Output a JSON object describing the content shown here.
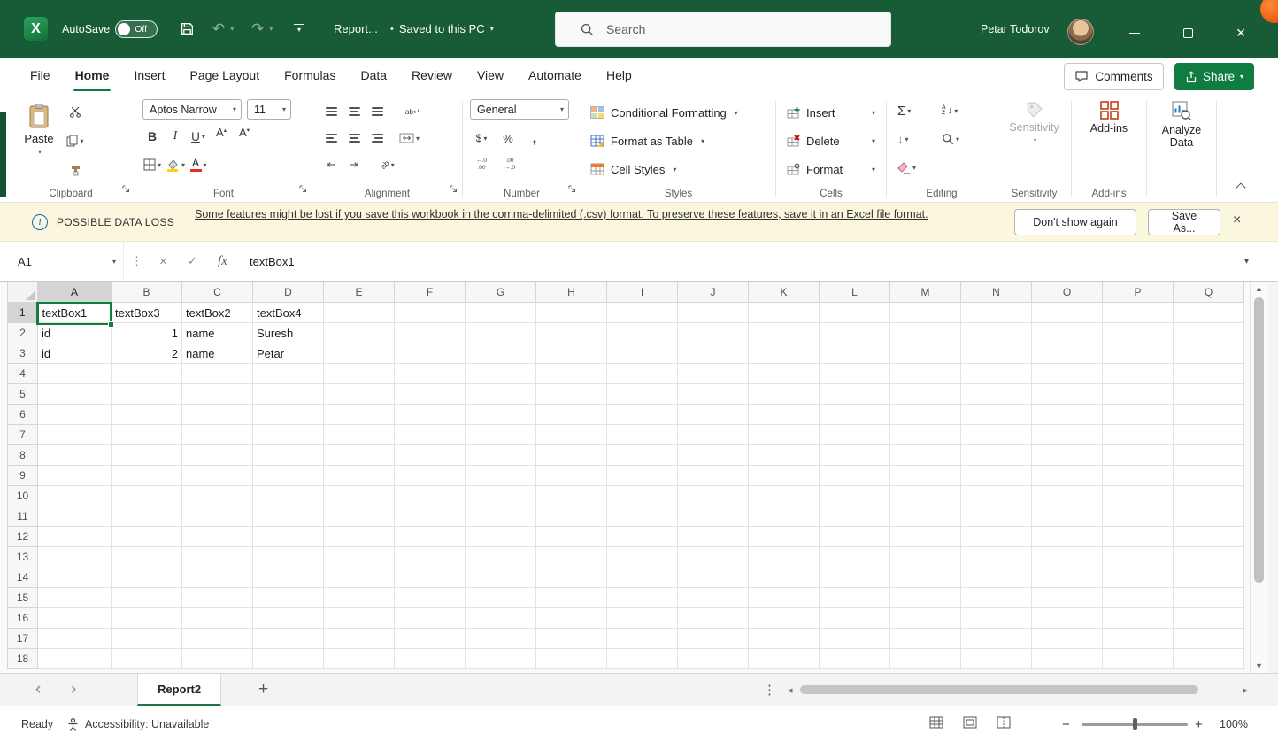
{
  "titlebar": {
    "autosave_label": "AutoSave",
    "autosave_state": "Off",
    "doc_title": "Report...",
    "saved_status": "Saved to this PC",
    "search_placeholder": "Search",
    "user_name": "Petar Todorov"
  },
  "menubar": {
    "tabs": [
      {
        "label": "File",
        "active": false
      },
      {
        "label": "Home",
        "active": true
      },
      {
        "label": "Insert",
        "active": false
      },
      {
        "label": "Page Layout",
        "active": false
      },
      {
        "label": "Formulas",
        "active": false
      },
      {
        "label": "Data",
        "active": false
      },
      {
        "label": "Review",
        "active": false
      },
      {
        "label": "View",
        "active": false
      },
      {
        "label": "Automate",
        "active": false
      },
      {
        "label": "Help",
        "active": false
      }
    ],
    "comments_label": "Comments",
    "share_label": "Share"
  },
  "ribbon": {
    "clipboard": {
      "paste": "Paste",
      "group": "Clipboard"
    },
    "font": {
      "font_name": "Aptos Narrow",
      "font_size": "11",
      "group": "Font"
    },
    "alignment": {
      "group": "Alignment"
    },
    "number": {
      "format": "General",
      "group": "Number"
    },
    "styles": {
      "conditional_formatting": "Conditional Formatting",
      "format_as_table": "Format as Table",
      "cell_styles": "Cell Styles",
      "group": "Styles"
    },
    "cells": {
      "insert": "Insert",
      "delete": "Delete",
      "format": "Format",
      "group": "Cells"
    },
    "editing": {
      "group": "Editing"
    },
    "sensitivity": {
      "label": "Sensitivity",
      "group": "Sensitivity"
    },
    "addins": {
      "label": "Add-ins",
      "group": "Add-ins"
    },
    "analyze": {
      "label": "Analyze Data"
    }
  },
  "glyphs": {
    "app_logo": "X",
    "bold": "B",
    "italic": "I",
    "underline": "U",
    "font_letter": "A",
    "sum": "Σ",
    "accounting": "$",
    "percent": "%",
    "comma": ",",
    "inc_top": "←.0",
    "inc_bot": ".00",
    "dec_top": ".00",
    "dec_bot": "→.0",
    "wrap_text": "ab",
    "wrap_arrow": "↵",
    "orientation": "ab",
    "sort_a": "A",
    "sort_z": "Z",
    "info": "i"
  },
  "notification": {
    "title": "POSSIBLE DATA LOSS",
    "message": "Some features might be lost if you save this workbook in the comma-delimited (.csv) format. To preserve these features, save it in an Excel file format.",
    "dismiss_label": "Don't show again",
    "save_as_label": "Save As..."
  },
  "formula_bar": {
    "name_box": "A1",
    "fx_label": "fx",
    "content": "textBox1"
  },
  "grid": {
    "columns": [
      "A",
      "B",
      "C",
      "D",
      "E",
      "F",
      "G",
      "H",
      "I",
      "J",
      "K",
      "L",
      "M",
      "N",
      "O",
      "P",
      "Q"
    ],
    "row_count": 18,
    "selection": {
      "row": 1,
      "col": "A"
    },
    "cells": [
      {
        "row": 1,
        "col": "A",
        "value": "textBox1"
      },
      {
        "row": 1,
        "col": "B",
        "value": "textBox3"
      },
      {
        "row": 1,
        "col": "C",
        "value": "textBox2"
      },
      {
        "row": 1,
        "col": "D",
        "value": "textBox4"
      },
      {
        "row": 2,
        "col": "A",
        "value": "id"
      },
      {
        "row": 2,
        "col": "B",
        "value": "1",
        "align": "right"
      },
      {
        "row": 2,
        "col": "C",
        "value": "name"
      },
      {
        "row": 2,
        "col": "D",
        "value": "Suresh"
      },
      {
        "row": 3,
        "col": "A",
        "value": "id"
      },
      {
        "row": 3,
        "col": "B",
        "value": "2",
        "align": "right"
      },
      {
        "row": 3,
        "col": "C",
        "value": "name"
      },
      {
        "row": 3,
        "col": "D",
        "value": "Petar"
      }
    ]
  },
  "sheet_bar": {
    "tabs": [
      {
        "label": "Report2",
        "active": true
      }
    ]
  },
  "status_bar": {
    "status": "Ready",
    "accessibility": "Accessibility: Unavailable",
    "zoom": "100%"
  },
  "colors": {
    "titlebar_green": "#185C37",
    "accent_green": "#107C41",
    "warning_bg": "#FBF6DE",
    "selection_border": "#107C41"
  }
}
